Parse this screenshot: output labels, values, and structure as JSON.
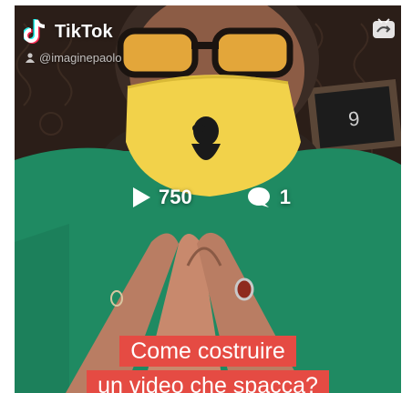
{
  "app": {
    "brand_name": "TikTok",
    "handle": "@imaginepaolo"
  },
  "video": {
    "views": "750",
    "comments": "1",
    "caption_lines": [
      "Come costruire",
      "un video che spacca?"
    ]
  },
  "colors": {
    "caption_bg": "#e54b43",
    "shirt": "#1f8a62",
    "mask": "#f2d24a",
    "glasses": "#e3a63a"
  },
  "icons": [
    "tiktok-logo-icon",
    "user-icon",
    "embed-icon",
    "play-icon",
    "comment-icon"
  ]
}
